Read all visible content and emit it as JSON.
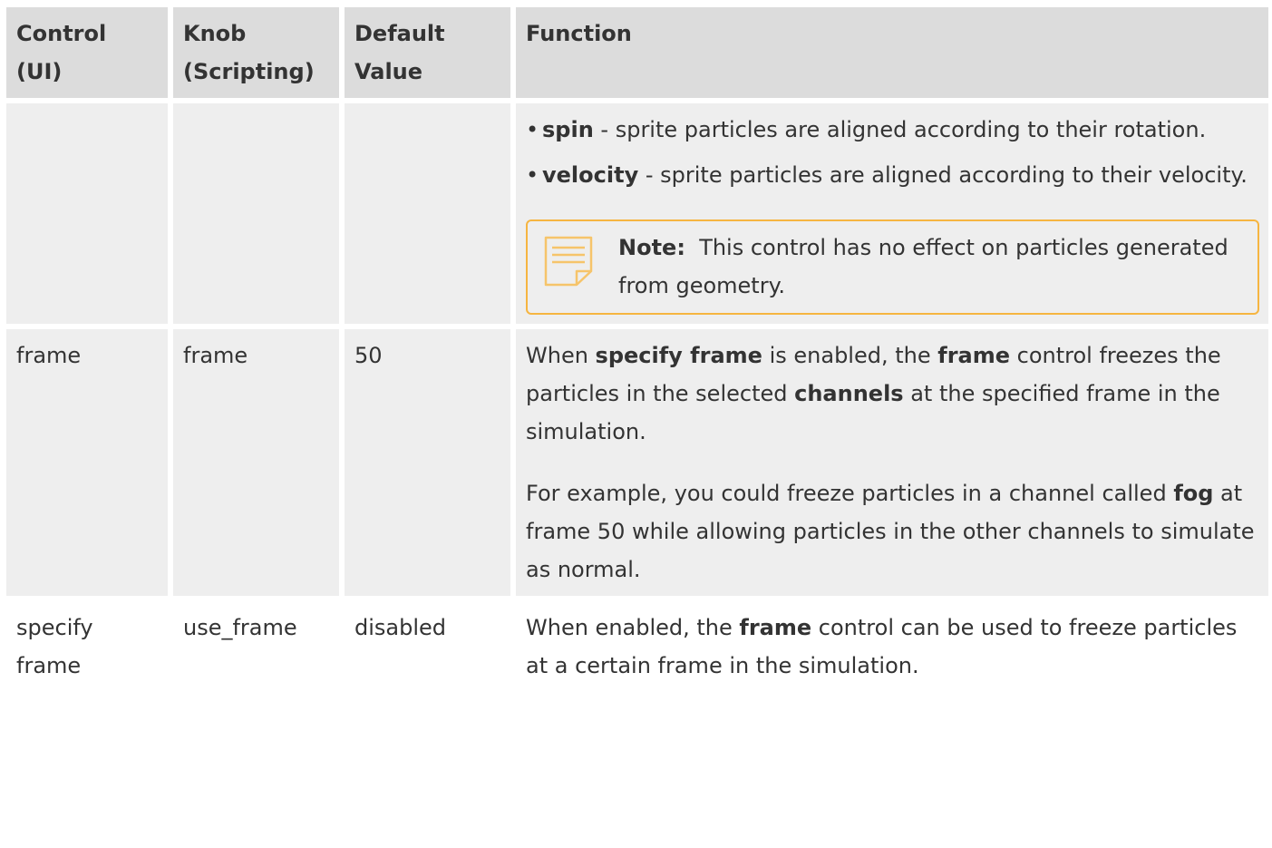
{
  "table": {
    "headers": {
      "control": "Control (UI)",
      "knob": "Knob (Scripting)",
      "default": "Default Value",
      "function": "Function"
    },
    "row_alignment": {
      "bullets": [
        {
          "term": "spin",
          "desc": " - sprite particles are aligned according to their rotation."
        },
        {
          "term": "velocity",
          "desc": " - sprite particles are aligned according to their velocity."
        }
      ],
      "note": {
        "label": "Note:",
        "text": "This control has no effect on particles generated from geometry."
      }
    },
    "row_frame": {
      "control": "frame",
      "knob": "frame",
      "default": "50",
      "p1": {
        "t1": "When ",
        "b1": "specify frame",
        "t2": " is enabled, the ",
        "b2": "frame",
        "t3": " control freezes the particles in the selected ",
        "b3": "channels",
        "t4": " at the specified frame in the simulation."
      },
      "p2": {
        "t1": "For example, you could freeze particles in a channel called ",
        "b1": "fog",
        "t2": " at frame 50 while allowing particles in the other channels to simulate as normal."
      }
    },
    "row_specify_frame": {
      "control": "specify frame",
      "knob": "use_frame",
      "default": "disabled",
      "p1": {
        "t1": "When enabled, the ",
        "b1": "frame",
        "t2": " control can be used to freeze particles at a certain frame in the simulation."
      }
    }
  },
  "colors": {
    "header_bg": "#dcdcdc",
    "shaded_row_bg": "#eeeeee",
    "note_border": "#f6b541",
    "text": "#333333"
  },
  "icons": {
    "note": "note-icon"
  }
}
